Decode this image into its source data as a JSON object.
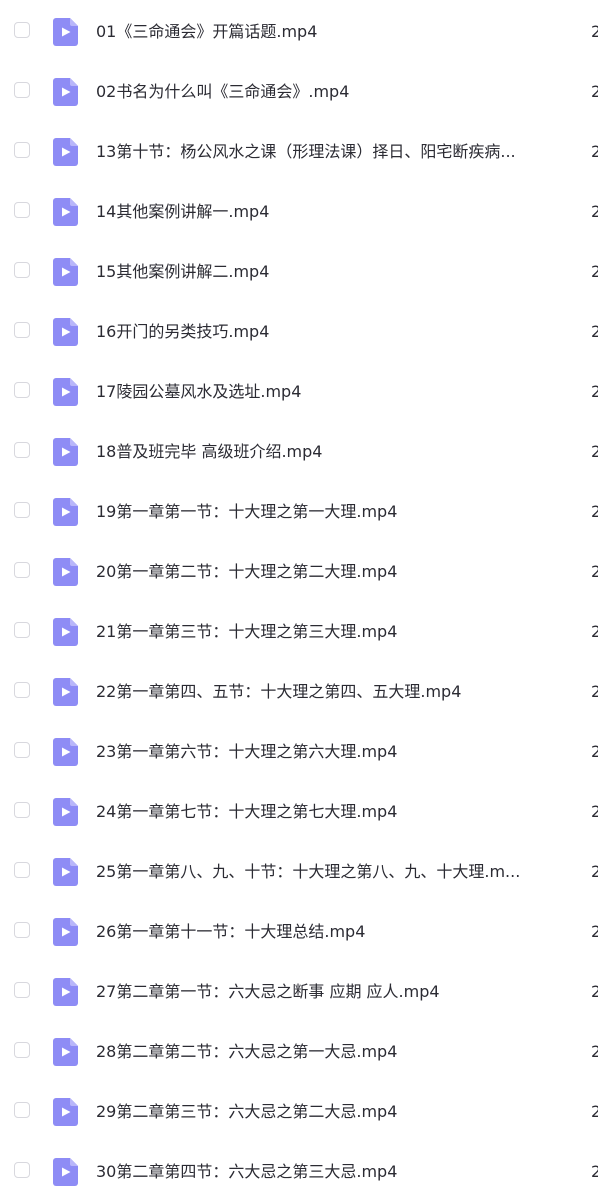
{
  "colors": {
    "icon_fill": "#8e8cf5",
    "icon_fold": "#b9b7fa",
    "text": "#2b2b33",
    "checkbox_border": "#d8d8de"
  },
  "icons": {
    "file": "video-file-icon"
  },
  "files": [
    {
      "name": "01《三命通会》开篇话题.mp4",
      "size": "2"
    },
    {
      "name": "02书名为什么叫《三命通会》.mp4",
      "size": "2"
    },
    {
      "name": "13第十节：杨公风水之课（形理法课）择日、阳宅断疾病...",
      "size": "2"
    },
    {
      "name": "14其他案例讲解一.mp4",
      "size": "2"
    },
    {
      "name": "15其他案例讲解二.mp4",
      "size": "2"
    },
    {
      "name": "16开门的另类技巧.mp4",
      "size": "2"
    },
    {
      "name": "17陵园公墓风水及选址.mp4",
      "size": "2"
    },
    {
      "name": "18普及班完毕 高级班介绍.mp4",
      "size": "2"
    },
    {
      "name": "19第一章第一节：十大理之第一大理.mp4",
      "size": "2"
    },
    {
      "name": "20第一章第二节：十大理之第二大理.mp4",
      "size": "2"
    },
    {
      "name": "21第一章第三节：十大理之第三大理.mp4",
      "size": "2"
    },
    {
      "name": "22第一章第四、五节：十大理之第四、五大理.mp4",
      "size": "2"
    },
    {
      "name": "23第一章第六节：十大理之第六大理.mp4",
      "size": "2"
    },
    {
      "name": "24第一章第七节：十大理之第七大理.mp4",
      "size": "2"
    },
    {
      "name": "25第一章第八、九、十节：十大理之第八、九、十大理.m...",
      "size": "2"
    },
    {
      "name": "26第一章第十一节：十大理总结.mp4",
      "size": "2"
    },
    {
      "name": "27第二章第一节：六大忌之断事 应期 应人.mp4",
      "size": "2"
    },
    {
      "name": "28第二章第二节：六大忌之第一大忌.mp4",
      "size": "2"
    },
    {
      "name": "29第二章第三节：六大忌之第二大忌.mp4",
      "size": "2"
    },
    {
      "name": "30第二章第四节：六大忌之第三大忌.mp4",
      "size": "2"
    }
  ]
}
